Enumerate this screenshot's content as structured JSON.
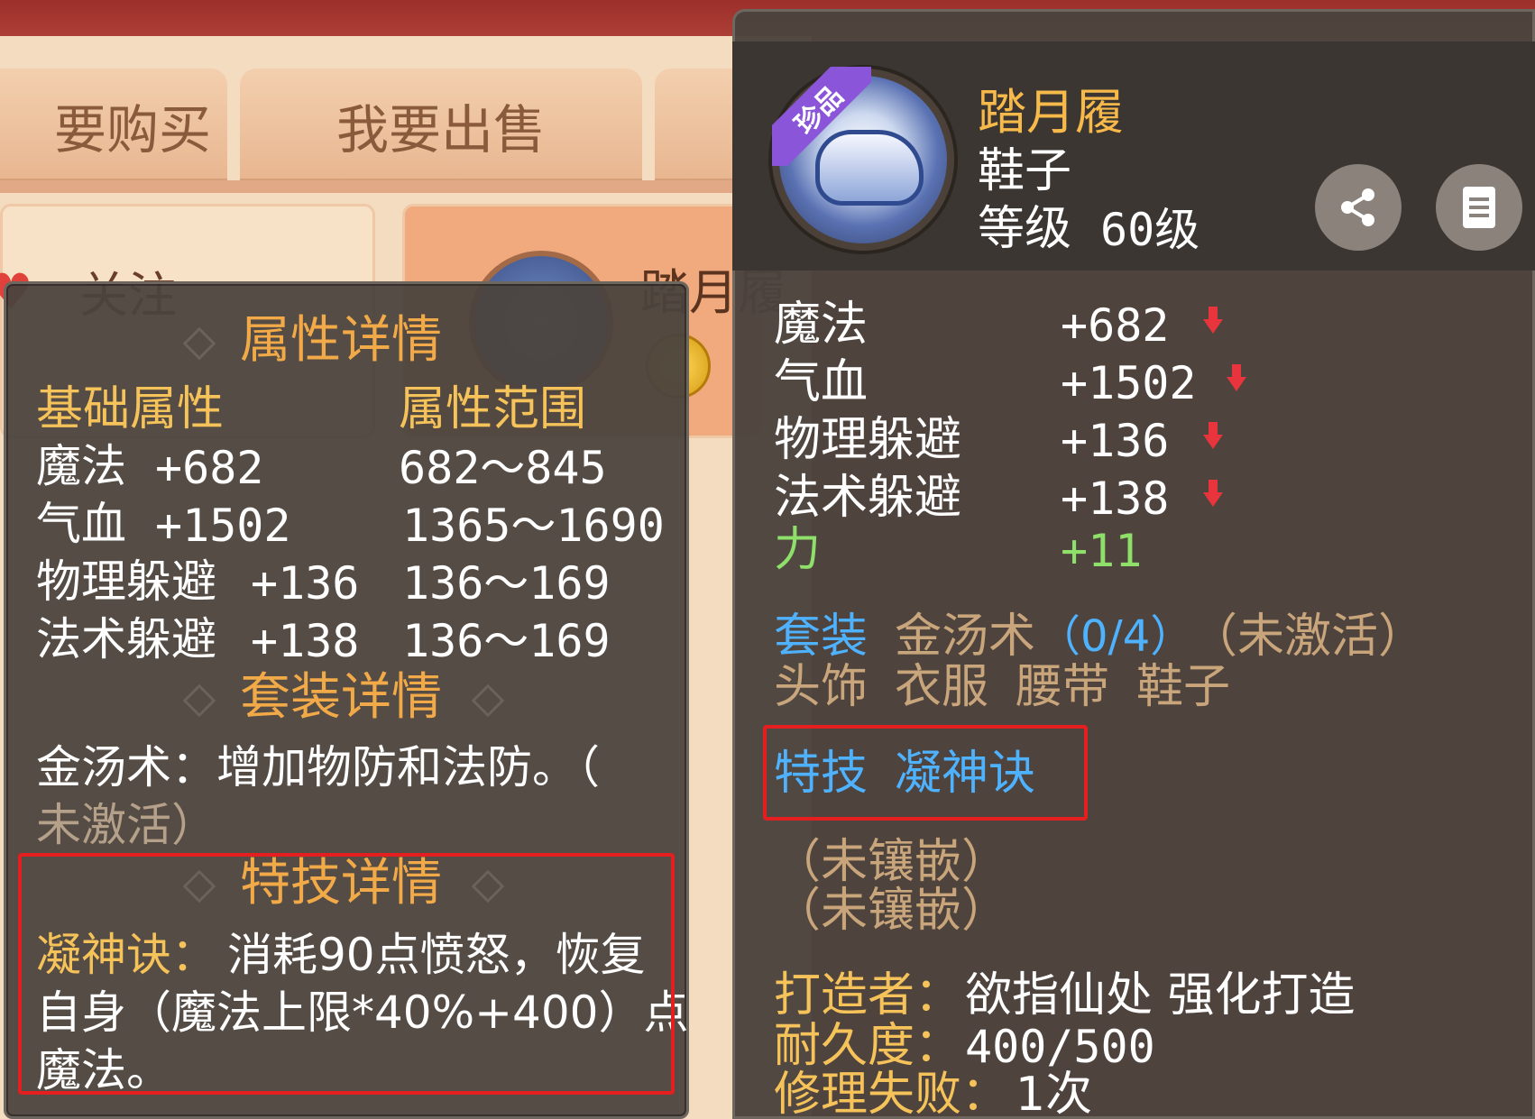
{
  "background": {
    "tabs": [
      "要购买",
      "我要出售",
      ""
    ],
    "follow_label": "关注",
    "item_name": "踏月履"
  },
  "left_tooltip": {
    "attr_title": "属性详情",
    "col_base": "基础属性",
    "col_range": "属性范围",
    "rows": [
      {
        "name": "魔法",
        "value": "+682",
        "range": "682～845"
      },
      {
        "name": "气血",
        "value": "+1502",
        "range": "1365～1690"
      },
      {
        "name": "物理躲避",
        "value": "+136",
        "range": "136～169"
      },
      {
        "name": "法术躲避",
        "value": "+138",
        "range": "136～169"
      }
    ],
    "set_title": "套装详情",
    "set_desc_line1": "金汤术：增加物防和法防。（",
    "set_desc_line2": "未激活）",
    "skill_title": "特技详情",
    "skill_name": "凝神诀：",
    "skill_desc_line1": "消耗90点愤怒，恢复",
    "skill_desc_line2": "自身（魔法上限*40%+400）点",
    "skill_desc_line3": "魔法。"
  },
  "right_tooltip": {
    "rare_badge": "珍品",
    "item_name": "踏月履",
    "item_type": "鞋子",
    "level_label": "等级",
    "level_value": "60级",
    "share_icon": "share-icon",
    "detail_icon": "document-icon",
    "stats": [
      {
        "name": "魔法",
        "value": "+682",
        "arrow": "down"
      },
      {
        "name": "气血",
        "value": "+1502",
        "arrow": "down"
      },
      {
        "name": "物理躲避",
        "value": "+136",
        "arrow": "down"
      },
      {
        "name": "法术躲避",
        "value": "+138",
        "arrow": "down"
      }
    ],
    "bonus": {
      "name": "力",
      "value": "+11"
    },
    "set_label": "套装",
    "set_name": "金汤术",
    "set_progress": "（0/4）",
    "set_status": "（未激活）",
    "set_parts": [
      "头饰",
      "衣服",
      "腰带",
      "鞋子"
    ],
    "skill_label": "特技",
    "skill_name": "凝神诀",
    "gems": [
      "（未镶嵌）",
      "（未镶嵌）"
    ],
    "maker_label": "打造者：",
    "maker_value": "欲指仙处 强化打造",
    "durability_label": "耐久度：",
    "durability_value": "400/500",
    "repair_label": "修理失败：",
    "repair_value": "1次"
  },
  "colors": {
    "title_orange": "#f2a948",
    "gold": "#f6c35a",
    "blue": "#4fb2ff",
    "green": "#8fe06a",
    "highlight_red": "#e51f1f",
    "panel_bg": "#4b433e"
  }
}
